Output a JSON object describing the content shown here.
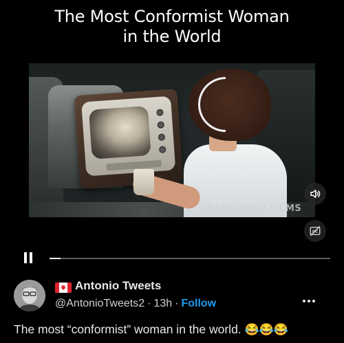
{
  "video": {
    "caption_title_line1": "The Most Conformist Woman",
    "caption_title_line2": "in the World",
    "watermark": "ABANDONED FILMS",
    "progress_fraction": 0.04,
    "volume_icon": "speaker-icon",
    "captions_icon": "closed-captions-icon",
    "pause_icon": "pause-icon"
  },
  "post": {
    "author_flag": "canada-flag",
    "author_name": "Antonio Tweets",
    "handle": "@AntonioTweets2",
    "time_ago": "13h",
    "follow_label": "Follow",
    "text": "The most “conformist” woman in the world.",
    "emojis": "😂😂😂",
    "more_icon": "more-options-icon"
  },
  "colors": {
    "accent": "#1d9bf0",
    "background": "#000000",
    "text": "#e7e9ea"
  }
}
